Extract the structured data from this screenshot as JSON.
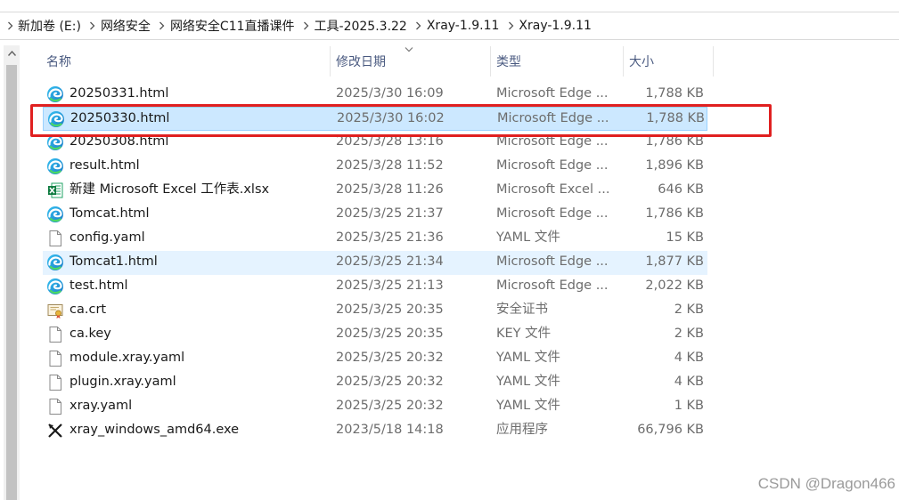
{
  "breadcrumb": [
    "新加卷 (E:)",
    "网络安全",
    "网络安全C11直播课件",
    "工具-2025.3.22",
    "Xray-1.9.11",
    "Xray-1.9.11"
  ],
  "columns": {
    "name": "名称",
    "date": "修改日期",
    "type": "类型",
    "size": "大小"
  },
  "files": [
    {
      "name": "20250331.html",
      "date": "2025/3/30 16:09",
      "type": "Microsoft Edge ...",
      "size": "1,788 KB",
      "icon": "edge-icon",
      "state": ""
    },
    {
      "name": "20250330.html",
      "date": "2025/3/30 16:02",
      "type": "Microsoft Edge ...",
      "size": "1,788 KB",
      "icon": "edge-icon",
      "state": "selected"
    },
    {
      "name": "20250308.html",
      "date": "2025/3/28 13:16",
      "type": "Microsoft Edge ...",
      "size": "1,786 KB",
      "icon": "edge-icon",
      "state": ""
    },
    {
      "name": "result.html",
      "date": "2025/3/28 11:52",
      "type": "Microsoft Edge ...",
      "size": "1,896 KB",
      "icon": "edge-icon",
      "state": ""
    },
    {
      "name": "新建 Microsoft Excel 工作表.xlsx",
      "date": "2025/3/28 11:26",
      "type": "Microsoft Excel ...",
      "size": "646 KB",
      "icon": "excel-icon",
      "state": ""
    },
    {
      "name": "Tomcat.html",
      "date": "2025/3/25 21:37",
      "type": "Microsoft Edge ...",
      "size": "1,786 KB",
      "icon": "edge-icon",
      "state": ""
    },
    {
      "name": "config.yaml",
      "date": "2025/3/25 21:36",
      "type": "YAML 文件",
      "size": "15 KB",
      "icon": "document-icon",
      "state": ""
    },
    {
      "name": "Tomcat1.html",
      "date": "2025/3/25 21:34",
      "type": "Microsoft Edge ...",
      "size": "1,877 KB",
      "icon": "edge-icon",
      "state": "hover"
    },
    {
      "name": "test.html",
      "date": "2025/3/25 21:13",
      "type": "Microsoft Edge ...",
      "size": "2,022 KB",
      "icon": "edge-icon",
      "state": ""
    },
    {
      "name": "ca.crt",
      "date": "2025/3/25 20:35",
      "type": "安全证书",
      "size": "2 KB",
      "icon": "certificate-icon",
      "state": ""
    },
    {
      "name": "ca.key",
      "date": "2025/3/25 20:35",
      "type": "KEY 文件",
      "size": "2 KB",
      "icon": "document-icon",
      "state": ""
    },
    {
      "name": "module.xray.yaml",
      "date": "2025/3/25 20:32",
      "type": "YAML 文件",
      "size": "4 KB",
      "icon": "document-icon",
      "state": ""
    },
    {
      "name": "plugin.xray.yaml",
      "date": "2025/3/25 20:32",
      "type": "YAML 文件",
      "size": "4 KB",
      "icon": "document-icon",
      "state": ""
    },
    {
      "name": "xray.yaml",
      "date": "2025/3/25 20:32",
      "type": "YAML 文件",
      "size": "1 KB",
      "icon": "document-icon",
      "state": ""
    },
    {
      "name": "xray_windows_amd64.exe",
      "date": "2023/5/18 14:18",
      "type": "应用程序",
      "size": "66,796 KB",
      "icon": "xray-exe-icon",
      "state": ""
    }
  ],
  "colors": {
    "selected_bg": "#cce8ff",
    "hover_bg": "#e5f3ff",
    "annotation": "#e02020",
    "header_text": "#4a5a80"
  },
  "watermark": "CSDN @Dragon466"
}
